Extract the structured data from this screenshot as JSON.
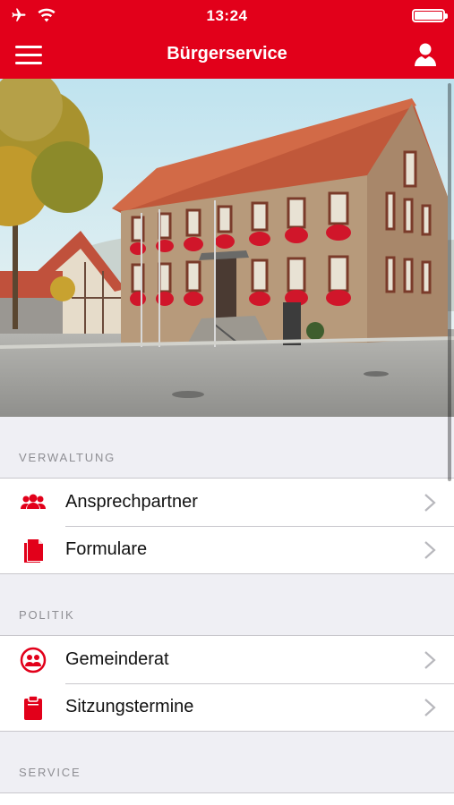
{
  "status_bar": {
    "time": "13:24",
    "icons": [
      "airplane-icon",
      "wifi-icon",
      "battery-icon"
    ]
  },
  "nav": {
    "title": "Bürgerservice",
    "left_icon": "menu-icon",
    "right_icon": "profile-icon"
  },
  "colors": {
    "brand": "#e2001a",
    "background": "#efeff4",
    "header_text": "#8e8e93"
  },
  "sections": [
    {
      "title": "VERWALTUNG",
      "items": [
        {
          "label": "Ansprechpartner",
          "icon": "group-icon"
        },
        {
          "label": "Formulare",
          "icon": "documents-icon"
        }
      ]
    },
    {
      "title": "POLITIK",
      "items": [
        {
          "label": "Gemeinderat",
          "icon": "council-icon"
        },
        {
          "label": "Sitzungstermine",
          "icon": "clipboard-icon"
        }
      ]
    },
    {
      "title": "SERVICE",
      "items": []
    }
  ]
}
